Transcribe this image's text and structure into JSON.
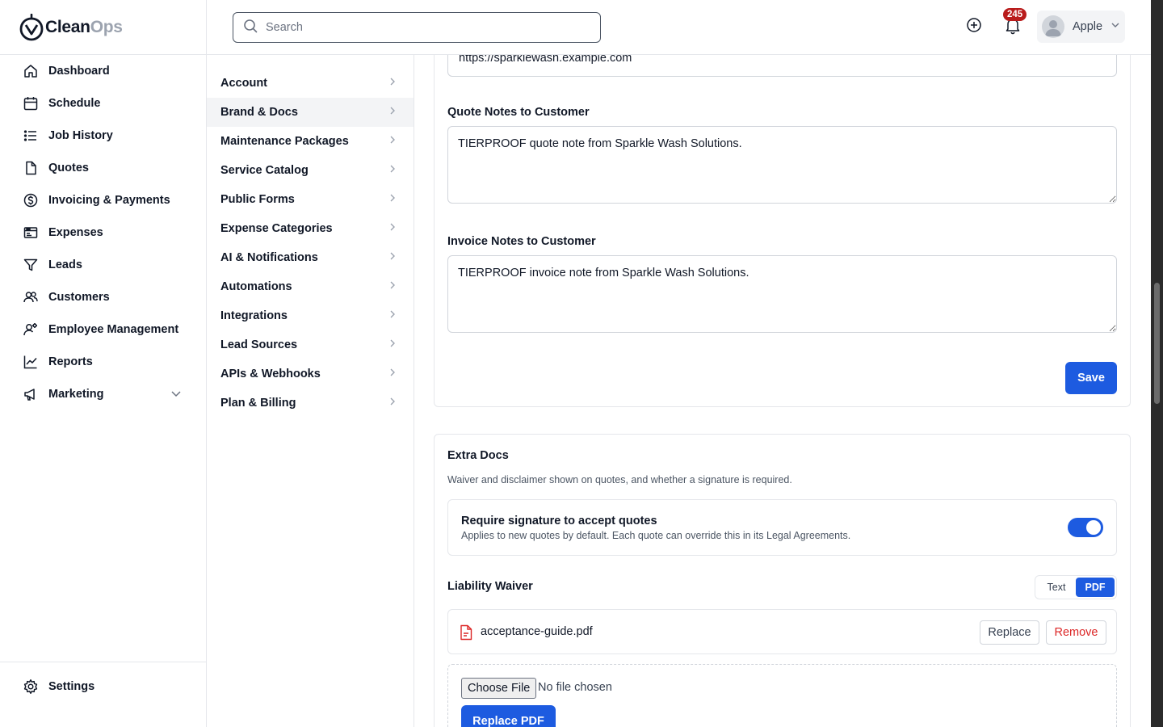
{
  "brand": {
    "name_part1": "Clean",
    "name_part2": "Ops"
  },
  "sidebar": {
    "items": [
      {
        "label": "Dashboard",
        "icon": "home-icon"
      },
      {
        "label": "Schedule",
        "icon": "calendar-icon"
      },
      {
        "label": "Job History",
        "icon": "list-icon"
      },
      {
        "label": "Quotes",
        "icon": "document-icon"
      },
      {
        "label": "Invoicing & Payments",
        "icon": "dollar-circle-icon"
      },
      {
        "label": "Expenses",
        "icon": "receipt-icon"
      },
      {
        "label": "Leads",
        "icon": "funnel-icon"
      },
      {
        "label": "Customers",
        "icon": "users-icon"
      },
      {
        "label": "Employee Management",
        "icon": "user-gear-icon"
      },
      {
        "label": "Reports",
        "icon": "trend-chart-icon"
      },
      {
        "label": "Marketing",
        "icon": "megaphone-icon"
      }
    ],
    "footer_label": "Settings"
  },
  "topbar": {
    "search_placeholder": "Search",
    "notification_count": "245",
    "user_name": "Apple"
  },
  "settings_nav": {
    "items": [
      "Account",
      "Brand & Docs",
      "Maintenance Packages",
      "Service Catalog",
      "Public Forms",
      "Expense Categories",
      "AI & Notifications",
      "Automations",
      "Integrations",
      "Lead Sources",
      "APIs & Webhooks",
      "Plan & Billing"
    ],
    "active": "Brand & Docs"
  },
  "brand_docs": {
    "website_value": "https://sparklewash.example.com",
    "quote_notes_label": "Quote Notes to Customer",
    "quote_notes_value": "TIERPROOF quote note from Sparkle Wash Solutions.",
    "invoice_notes_label": "Invoice Notes to Customer",
    "invoice_notes_value": "TIERPROOF invoice note from Sparkle Wash Solutions.",
    "save_label": "Save"
  },
  "extra_docs": {
    "title": "Extra Docs",
    "description": "Waiver and disclaimer shown on quotes, and whether a signature is required.",
    "signature_title": "Require signature to accept quotes",
    "signature_desc": "Applies to new quotes by default. Each quote can override this in its Legal Agreements.",
    "signature_required": true,
    "waiver_label": "Liability Waiver",
    "mode_text": "Text",
    "mode_pdf": "PDF",
    "mode_selected": "PDF",
    "file_name": "acceptance-guide.pdf",
    "replace_label": "Replace",
    "remove_label": "Remove",
    "choose_file_label": "Choose File",
    "no_file_label": "No file chosen",
    "replace_pdf_label": "Replace PDF"
  },
  "colors": {
    "primary": "#1d5be0",
    "badge": "#b91c1c",
    "danger": "#dc2626"
  }
}
